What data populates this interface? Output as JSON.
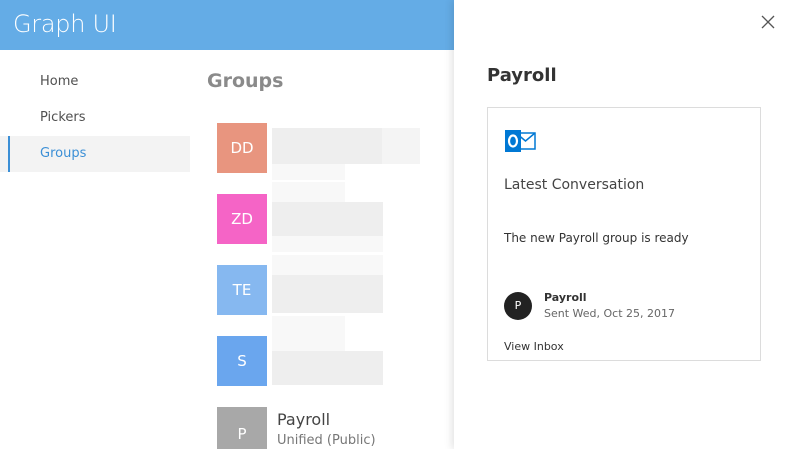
{
  "header": {
    "title": "Graph UI"
  },
  "sidebar": {
    "items": [
      {
        "label": "Home",
        "active": false
      },
      {
        "label": "Pickers",
        "active": false
      },
      {
        "label": "Groups",
        "active": true
      }
    ]
  },
  "main": {
    "title": "Groups",
    "groups": [
      {
        "initials": "DD",
        "color": "#e8957f",
        "name": "",
        "subtitle": ""
      },
      {
        "initials": "ZD",
        "color": "#f564c6",
        "name": "",
        "subtitle": ""
      },
      {
        "initials": "TE",
        "color": "#86b8f0",
        "name": "",
        "subtitle": ""
      },
      {
        "initials": "S",
        "color": "#6aa6ee",
        "name": "",
        "subtitle": ""
      },
      {
        "initials": "P",
        "color": "#a8a8a8",
        "name": "Payroll",
        "subtitle": "Unified (Public)"
      }
    ]
  },
  "panel": {
    "title": "Payroll",
    "close_icon": "close-icon",
    "card": {
      "app_icon": "outlook-icon",
      "heading": "Latest Conversation",
      "message": "The new Payroll group is ready",
      "sender": {
        "initial": "P",
        "name": "Payroll",
        "date": "Sent Wed, Oct 25, 2017"
      },
      "link": "View Inbox"
    }
  },
  "colors": {
    "header_bg": "#64ace6",
    "accent": "#3b8fd6",
    "outlook_blue": "#0078d4"
  }
}
